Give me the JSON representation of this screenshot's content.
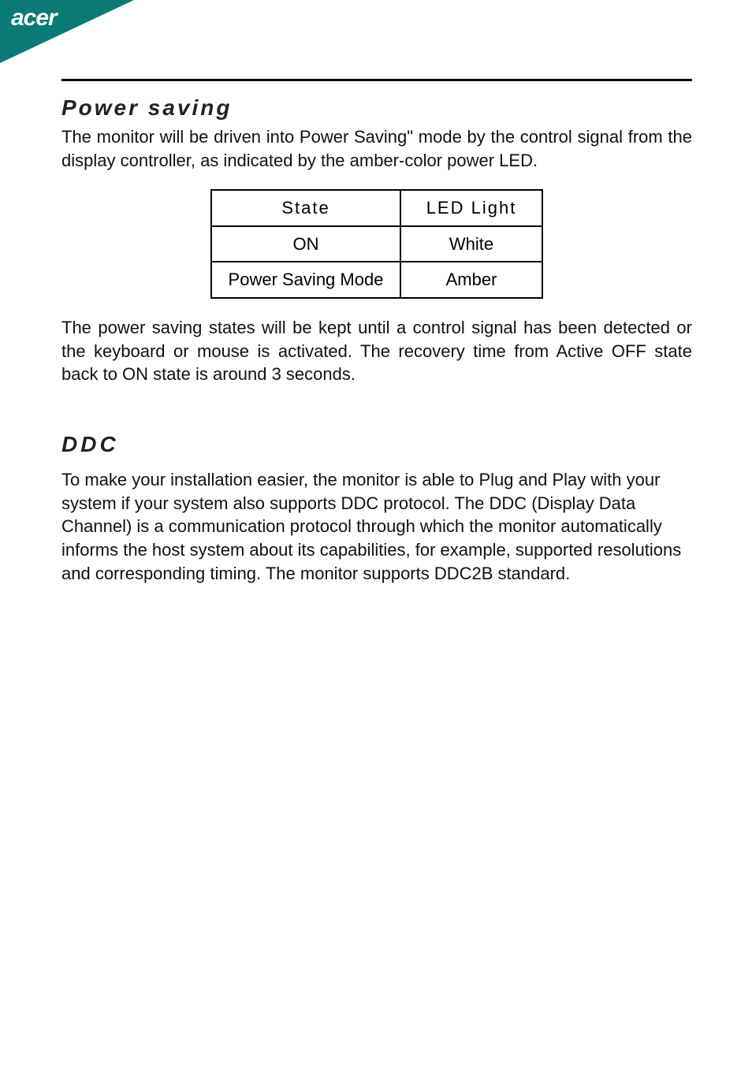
{
  "brand": "acer",
  "section1": {
    "heading": "Power saving",
    "intro": "The monitor will be driven into Power Saving\" mode by the control signal from the display controller, as indicated by the amber-color power LED.",
    "table": {
      "headers": {
        "state": "State",
        "led": "LED Light"
      },
      "rows": [
        {
          "state": "ON",
          "led": "White"
        },
        {
          "state": "Power Saving Mode",
          "led": "Amber"
        }
      ]
    },
    "outro": "The power saving states will be kept until a control signal has been detected or the keyboard or mouse is activated. The recovery time from Active OFF state back to ON state is around 3 seconds."
  },
  "section2": {
    "heading": "DDC",
    "body": "To make your installation easier, the monitor is able to Plug and Play with your system if your system also supports DDC protocol. The DDC (Display Data Channel) is a communication protocol through which the monitor automatically informs the host system  about its capabilities, for example, supported resolutions and corresponding timing. The monitor supports DDC2B standard."
  }
}
